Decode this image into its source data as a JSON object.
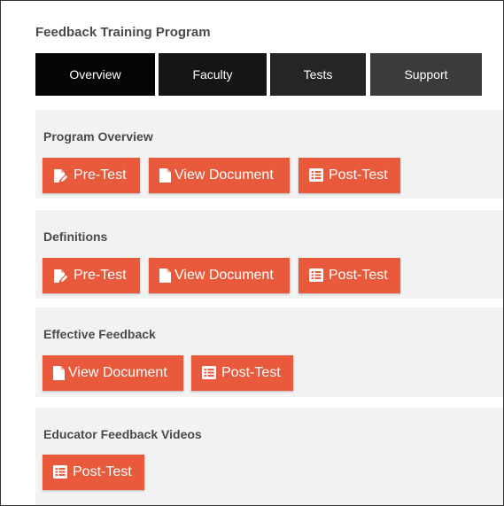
{
  "app": {
    "title": "Feedback Training Program"
  },
  "tabs": [
    {
      "label": "Overview"
    },
    {
      "label": "Faculty"
    },
    {
      "label": "Tests"
    },
    {
      "label": "Support"
    }
  ],
  "sections": [
    {
      "title": "Program Overview",
      "buttons": [
        {
          "label": "Pre-Test",
          "icon": "edit-icon"
        },
        {
          "label": "View Document",
          "icon": "document-icon"
        },
        {
          "label": "Post-Test",
          "icon": "list-icon"
        }
      ]
    },
    {
      "title": "Definitions",
      "buttons": [
        {
          "label": "Pre-Test",
          "icon": "edit-icon"
        },
        {
          "label": "View Document",
          "icon": "document-icon"
        },
        {
          "label": "Post-Test",
          "icon": "list-icon"
        }
      ]
    },
    {
      "title": "Effective Feedback",
      "buttons": [
        {
          "label": "View Document",
          "icon": "document-icon"
        },
        {
          "label": "Post-Test",
          "icon": "list-icon"
        }
      ]
    },
    {
      "title": "Educator Feedback Videos",
      "buttons": [
        {
          "label": "Post-Test",
          "icon": "list-icon"
        }
      ]
    }
  ],
  "colors": {
    "accent": "#e95a3c",
    "section_bg": "#f2f2f2",
    "title_text": "#4a4a4a"
  }
}
